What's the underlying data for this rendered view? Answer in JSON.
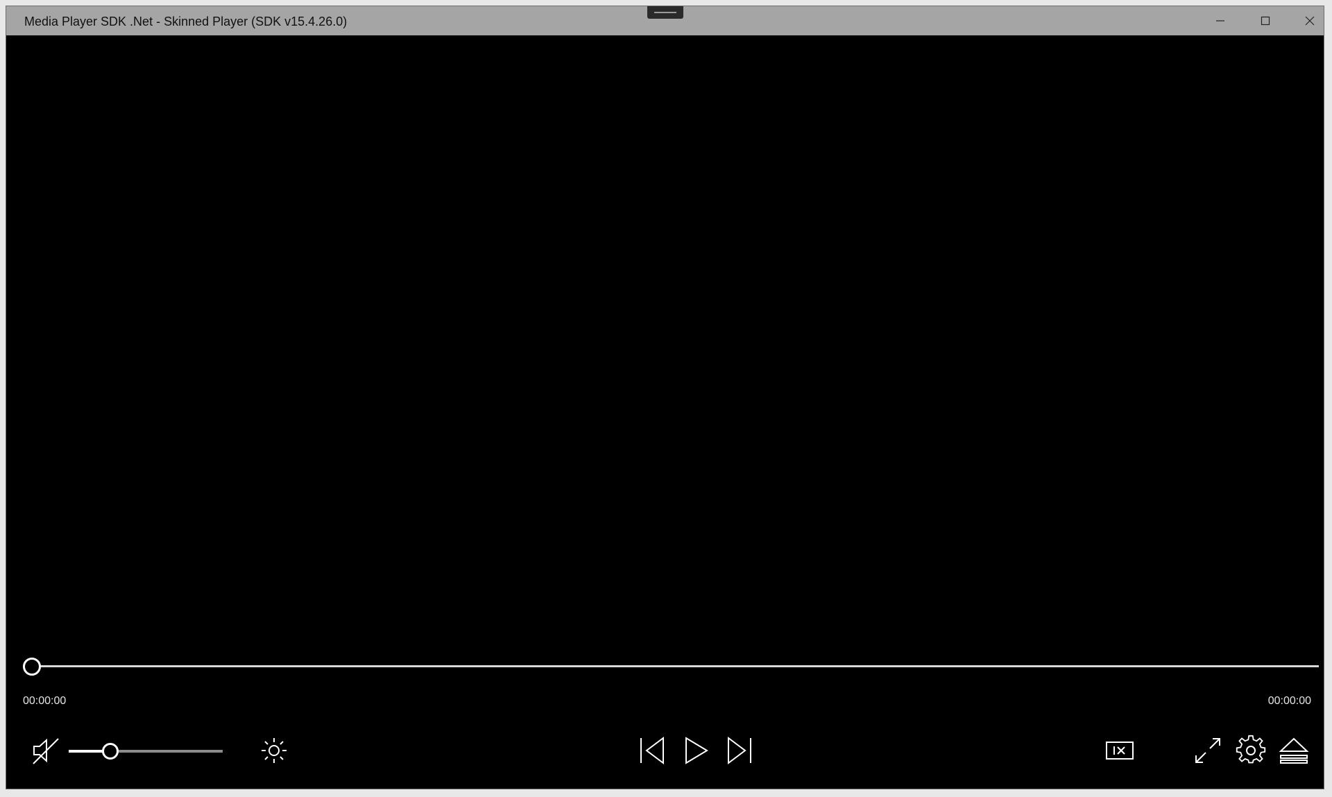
{
  "window": {
    "title": "Media Player SDK .Net - Skinned Player (SDK v15.4.26.0)"
  },
  "titlebar_buttons": {
    "minimize_icon": "minimize-icon",
    "maximize_icon": "maximize-icon",
    "close_icon": "close-icon"
  },
  "playback": {
    "position": "00:00:00",
    "duration": "00:00:00",
    "seek_progress": 0.0
  },
  "volume": {
    "level": 0.27,
    "muted": true
  },
  "controls": {
    "left": [
      "mute-icon",
      "brightness-icon"
    ],
    "center": [
      "previous-icon",
      "play-icon",
      "next-icon"
    ],
    "right": [
      "playback-speed-icon",
      "fullscreen-icon",
      "settings-icon",
      "eject-icon"
    ]
  },
  "colors": {
    "titlebar": "#a5a5a5",
    "video_area": "#000000",
    "controls": "#ffffff"
  }
}
